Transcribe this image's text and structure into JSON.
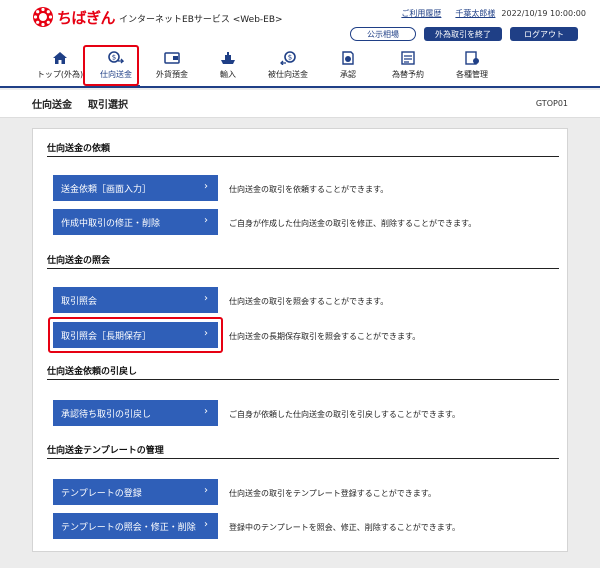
{
  "header": {
    "brand": "ちばぎん",
    "service": "インターネットEBサービス <Web-EB>",
    "help_link": "ご利用履歴",
    "user_name": "千葉太郎様",
    "datetime": "2022/10/19 10:00:00",
    "btn_rates": "公示相場",
    "btn_fx_end": "外為取引を終了",
    "btn_logout": "ログアウト"
  },
  "nav": {
    "items": [
      {
        "label": "トップ(外為)",
        "icon": "home-icon"
      },
      {
        "label": "仕向送金",
        "icon": "remittance-icon"
      },
      {
        "label": "外貨預金",
        "icon": "deposit-icon"
      },
      {
        "label": "輸入",
        "icon": "import-icon"
      },
      {
        "label": "被仕向送金",
        "icon": "inbound-icon"
      },
      {
        "label": "承認",
        "icon": "approve-icon"
      },
      {
        "label": "為替予約",
        "icon": "fx-contract-icon"
      },
      {
        "label": "各種管理",
        "icon": "admin-icon"
      }
    ]
  },
  "title": {
    "main": "仕向送金",
    "sub": "取引選択",
    "code": "GTOP01"
  },
  "sections": [
    {
      "title": "仕向送金の依頼"
    },
    {
      "title": "仕向送金の照会"
    },
    {
      "title": "仕向送金依頼の引戻し"
    },
    {
      "title": "仕向送金テンプレートの管理"
    }
  ],
  "actions": [
    {
      "label": "送金依頼［画面入力］",
      "desc": "仕向送金の取引を依頼することができます。"
    },
    {
      "label": "作成中取引の修正・削除",
      "desc": "ご自身が作成した仕向送金の取引を修正、削除することができます。"
    },
    {
      "label": "取引照会",
      "desc": "仕向送金の取引を照会することができます。"
    },
    {
      "label": "取引照会［長期保存］",
      "desc": "仕向送金の長期保存取引を照会することができます。"
    },
    {
      "label": "承認待ち取引の引戻し",
      "desc": "ご自身が依頼した仕向送金の取引を引戻しすることができます。"
    },
    {
      "label": "テンプレートの登録",
      "desc": "仕向送金の取引をテンプレート登録することができます。"
    },
    {
      "label": "テンプレートの照会・修正・削除",
      "desc": "登録中のテンプレートを照会、修正、削除することができます。"
    }
  ],
  "colors": {
    "accent": "#1f3f86",
    "button": "#2f5fb8",
    "highlight": "#e60012"
  }
}
